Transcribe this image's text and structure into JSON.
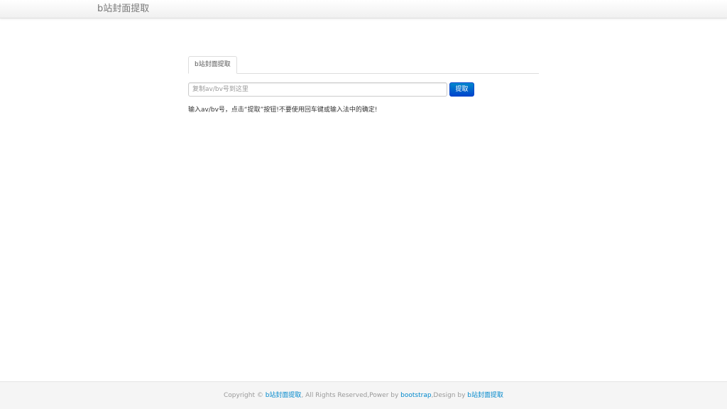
{
  "header": {
    "brand": "b站封面提取"
  },
  "main": {
    "tabs": [
      {
        "label": "b站封面提取",
        "active": true
      }
    ],
    "input": {
      "value": "",
      "placeholder": "复制av/bv号到这里"
    },
    "submit_label": "提取",
    "hint": "输入av/bv号，点击“提取”按钮!不要使用回车键或输入法中的确定!"
  },
  "footer": {
    "prefix": "Copyright © ",
    "site_link": "b站封面提取",
    "rights": ", All Rights Reserved,Power by ",
    "bootstrap_link": "bootstrap",
    "design_by": ",Design by ",
    "designer_link": "b站封面提取"
  },
  "colors": {
    "link": "#0088cc",
    "button": "#0055cc",
    "footer_bg": "#f5f5f5"
  }
}
